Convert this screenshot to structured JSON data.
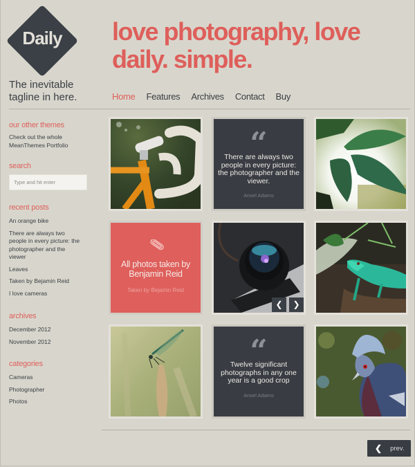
{
  "brand": {
    "logo_text": "Daily",
    "tagline": "The inevitable tagline in here.",
    "accent_color": "#de5f5b",
    "dark_color": "#393c43"
  },
  "hero": {
    "headline": "love photography, love daily. simple."
  },
  "nav": {
    "items": [
      {
        "label": "Home",
        "active": true
      },
      {
        "label": "Features",
        "active": false
      },
      {
        "label": "Archives",
        "active": false
      },
      {
        "label": "Contact",
        "active": false
      },
      {
        "label": "Buy",
        "active": false
      }
    ]
  },
  "sidebar": {
    "other_themes": {
      "title": "our other themes",
      "text": "Check out the whole MeanThemes Portfolio"
    },
    "search": {
      "title": "search",
      "placeholder": "Type and hit enter",
      "value": ""
    },
    "recent_posts": {
      "title": "recent posts",
      "items": [
        "An orange bike",
        "There are always two people in every picture: the photographer and the viewer",
        "Leaves",
        "Taken by Bejamin Reid",
        "I love cameras"
      ]
    },
    "archives": {
      "title": "archives",
      "items": [
        "December 2012",
        "November 2012"
      ]
    },
    "categories": {
      "title": "categories",
      "items": [
        "Cameras",
        "Photographer",
        "Photos"
      ]
    }
  },
  "grid": {
    "tiles": [
      {
        "type": "photo",
        "subject": "orange bicycle handlebars"
      },
      {
        "type": "quote",
        "icon": "quote-icon",
        "text": "There are always two people in every picture: the photographer and the viewer.",
        "author": "Ansel Adams"
      },
      {
        "type": "photo",
        "subject": "backlit green leaves"
      },
      {
        "type": "link",
        "icon": "paperclip-icon",
        "title": "All photos taken by Benjamin Reid",
        "subtitle": "Taken by Bejamin Reid"
      },
      {
        "type": "gallery",
        "subject": "camera lens close-up",
        "prev_icon": "chevron-left-icon",
        "next_icon": "chevron-right-icon"
      },
      {
        "type": "photo",
        "subject": "green lizard on log"
      },
      {
        "type": "photo",
        "subject": "dragonfly on grass stem"
      },
      {
        "type": "quote",
        "icon": "quote-icon",
        "text": "Twelve significant photographs in any one year is a good crop",
        "author": "Ansel Adams"
      },
      {
        "type": "photo",
        "subject": "blue crowned pigeon"
      }
    ]
  },
  "pagination": {
    "prev_label": "prev."
  }
}
